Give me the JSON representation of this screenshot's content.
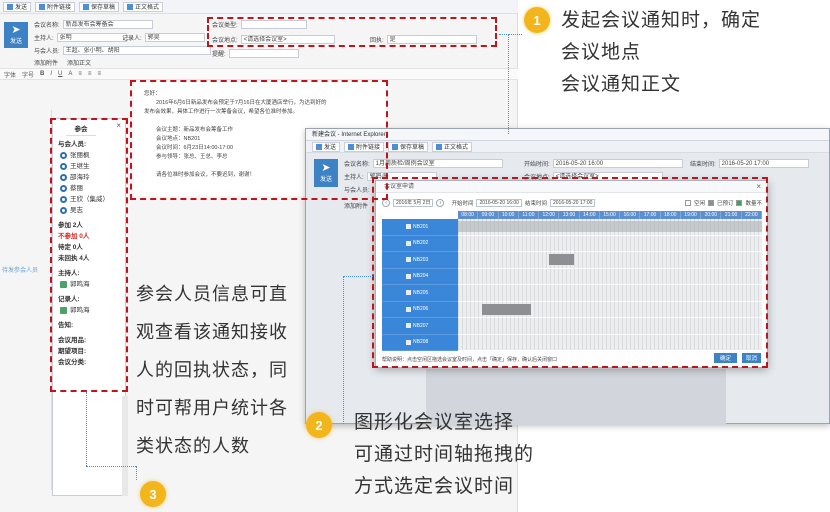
{
  "email": {
    "toolbar": [
      {
        "icon": "send-icon",
        "label": "发送"
      },
      {
        "icon": "attach-icon",
        "label": "附件链接"
      },
      {
        "icon": "save-icon",
        "label": "保存草稿"
      },
      {
        "icon": "format-icon",
        "label": "正文格式"
      }
    ],
    "send_label": "发送",
    "fields": {
      "subject_label": "会议名称:",
      "subject_value": "新品发布会筹备会",
      "attendee_label": "主持人:",
      "attendee_value": "张明",
      "recorder_label": "记录人:",
      "recorder_value": "郭昊",
      "cc_label": "与会人员:",
      "cc_value": "王超、张小明、胡阳",
      "type_label": "会议类型:",
      "type_value": "",
      "room_label": "会议地点:",
      "room_value": "<请选择会议室>",
      "reply_label": "回执:",
      "reply_value": "是",
      "notify_label": "提醒:",
      "notify_value": "",
      "attach_label": "添加附件",
      "word_label": "添加正文"
    },
    "format_bar": [
      "字体",
      "字号",
      "B",
      "I",
      "U",
      "A",
      "≡",
      "≡",
      "≡"
    ],
    "doc_lines": [
      "您好：",
      "2016年6月6日新品发布会预定于7月16日在大厦酒店举行，为达到好的",
      "发布会效果，具体工作进行一次筹备会议，希望各位准时参加。",
      "",
      "会议主题：新品发布会筹备工作",
      "会议地点：NB201",
      "会议时间：6月23日14:00-17:00",
      "参与领导：张总、王总、李总",
      "",
      "请各位准时参加会议，不要迟到，谢谢！"
    ]
  },
  "side_note": "待发参会人员",
  "attendee_panel": {
    "title": "参会",
    "close": "×",
    "sections": [
      {
        "label": "与会人员:",
        "people": [
          "张丽枫",
          "王继生",
          "邵海玲",
          "蔡丽",
          "王欣（集威）",
          "吴志"
        ]
      },
      {
        "label": "参加 2人",
        "people": []
      },
      {
        "label": "不参加 0人",
        "people": [],
        "red": true
      },
      {
        "label": "待定 0人",
        "people": []
      },
      {
        "label": "未回执 4人",
        "people": []
      },
      {
        "label": "主持人:",
        "people": [
          "郭鸣海"
        ]
      },
      {
        "label": "记录人:",
        "people": [
          "郭鸣海"
        ]
      },
      {
        "label": "告知:",
        "people": []
      },
      {
        "label": "会议用品:",
        "people": []
      },
      {
        "label": "期望项目:",
        "people": []
      },
      {
        "label": "会议分类:",
        "people": []
      }
    ]
  },
  "annotations": [
    {
      "badge": "1",
      "lines": [
        "发起会议通知时，确定",
        "会议地点",
        "会议通知正文"
      ]
    },
    {
      "badge": "2",
      "lines": [
        "图形化会议室选择",
        "可通过时间轴拖拽的",
        "方式选定会议时间"
      ]
    },
    {
      "badge": "3",
      "lines": [
        "参会人员信息可直",
        "观查看该通知接收",
        "人的回执状态，同",
        "时可帮用户统计各",
        "类状态的人数"
      ]
    }
  ],
  "ie_window": {
    "title": "新建会议 - Internet Explorer",
    "toolbar": [
      {
        "icon": "send-icon",
        "label": "发送"
      },
      {
        "icon": "attach-icon",
        "label": "附件链接"
      },
      {
        "icon": "save-icon",
        "label": "保存草稿"
      },
      {
        "icon": "format-icon",
        "label": "正文格式"
      }
    ],
    "send_label": "发送",
    "fields": {
      "subject_label": "会议名称:",
      "subject_value": "1月周质检/周例会议室",
      "start_label": "开始时间:",
      "start_value": "2016-05-20 16:00",
      "end_label": "结束时间:",
      "end_value": "2016-05-20 17:00",
      "host_label": "主持人:",
      "host_value": "郭鸣海",
      "room_label": "会议地点:",
      "room_value": "<请选择会议室>",
      "attendee_label": "与会人员:",
      "attach_label": "添加附件"
    }
  },
  "booking_dialog": {
    "title": "会议室申请",
    "close": "×",
    "date_value": "2016年 5月 2日",
    "start_label": "开始时间",
    "start_value": "2016-05-20 16:00",
    "end_label": "结束时间",
    "end_value": "2016-05-20 17:00",
    "legend": [
      {
        "label": "空闲",
        "color": "#ffffff"
      },
      {
        "label": "已预订",
        "color": "#8d8f93"
      },
      {
        "label": "数量不",
        "color": "#3ca357"
      }
    ],
    "hours": [
      "08:00",
      "09:00",
      "10:00",
      "11:00",
      "12:00",
      "13:00",
      "14:00",
      "15:00",
      "16:00",
      "17:00",
      "18:00",
      "19:00",
      "20:00",
      "21:00",
      "22:00"
    ],
    "rooms": [
      "NB201",
      "NB202",
      "NB203",
      "NB204",
      "NB205",
      "NB206",
      "NB207",
      "NB208"
    ],
    "bookings": [
      {
        "room": 0,
        "start": 0,
        "end": 15
      },
      {
        "room": 2,
        "start": 4.5,
        "end": 5.7
      },
      {
        "room": 5,
        "start": 1.2,
        "end": 3.6
      }
    ],
    "footer": "帮助说明：点击空闲区拖选会议室及时间，点击「确定」保存，确认后关闭窗口",
    "ok": "确定",
    "cancel": "取消"
  }
}
